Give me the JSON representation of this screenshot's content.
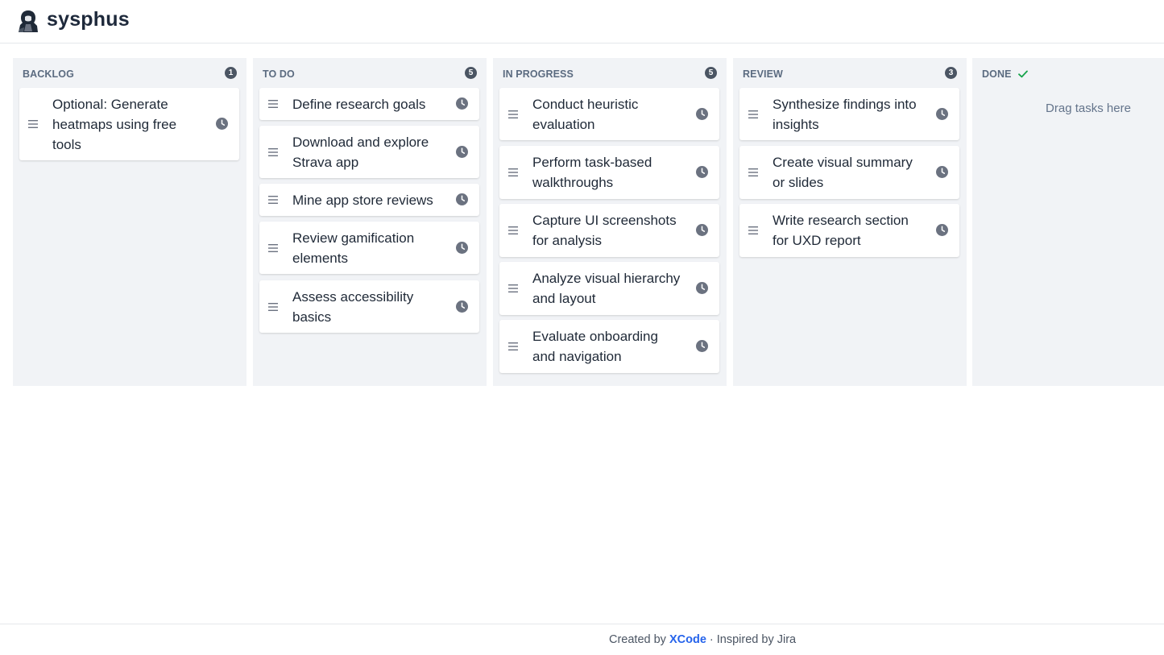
{
  "app": {
    "title": "sysphus",
    "logo_icon": "hooded-figure-logo-icon"
  },
  "colors": {
    "column_bg": "#f1f3f6",
    "badge_bg": "#4b5563",
    "done_check": "#16a34a",
    "link": "#2563eb",
    "icon_gray": "#6b7280"
  },
  "columns": [
    {
      "title": "BACKLOG",
      "count": "1",
      "cards": [
        {
          "text": "Optional: Generate heatmaps using free tools"
        }
      ]
    },
    {
      "title": "TO DO",
      "count": "5",
      "cards": [
        {
          "text": "Define research goals"
        },
        {
          "text": "Download and explore Strava app"
        },
        {
          "text": "Mine app store reviews"
        },
        {
          "text": "Review gamification elements"
        },
        {
          "text": "Assess accessibility basics"
        }
      ]
    },
    {
      "title": "IN PROGRESS",
      "count": "5",
      "cards": [
        {
          "text": "Conduct heuristic evaluation"
        },
        {
          "text": "Perform task-based walkthroughs"
        },
        {
          "text": "Capture UI screenshots for analysis"
        },
        {
          "text": "Analyze visual hierarchy and layout"
        },
        {
          "text": "Evaluate onboarding and navigation"
        }
      ]
    },
    {
      "title": "REVIEW",
      "count": "3",
      "cards": [
        {
          "text": "Synthesize findings into insights"
        },
        {
          "text": "Create visual summary or slides"
        },
        {
          "text": "Write research section for UXD report"
        }
      ]
    },
    {
      "title": "DONE",
      "status_icon": "checkmark-icon",
      "empty_hint": "Drag tasks here"
    }
  ],
  "footer": {
    "prefix": "Created by ",
    "link_text": "XCode",
    "suffix": " · Inspired by Jira"
  }
}
